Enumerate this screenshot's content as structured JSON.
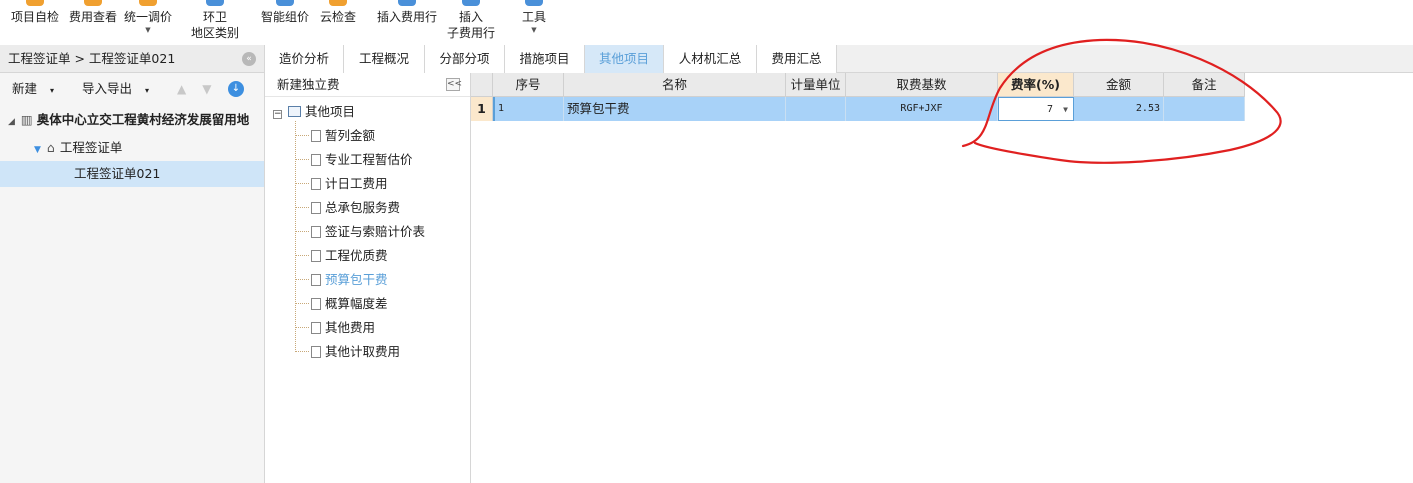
{
  "toolbar": {
    "buttons": [
      {
        "label": "项目自检"
      },
      {
        "label": "费用查看"
      },
      {
        "label": "统一调价"
      },
      {
        "label": "环卫",
        "label2": "地区类别"
      },
      {
        "label": "智能组价"
      },
      {
        "label": "云检查"
      },
      {
        "label": "插入费用行"
      },
      {
        "label": "插入",
        "label2": "子费用行"
      },
      {
        "label": "工具"
      }
    ]
  },
  "left_panel": {
    "breadcrumb": "工程签证单 > 工程签证单021",
    "new_label": "新建",
    "import_export_label": "导入导出",
    "project_name": "奥体中心立交工程黄村经济发展留用地",
    "node_label": "工程签证单",
    "selected_item": "工程签证单021"
  },
  "tabs": [
    "造价分析",
    "工程概况",
    "分部分项",
    "措施项目",
    "其他项目",
    "人材机汇总",
    "费用汇总"
  ],
  "active_tab": "其他项目",
  "middle_panel": {
    "header": "新建独立费",
    "root": "其他项目",
    "items": [
      "暂列金额",
      "专业工程暂估价",
      "计日工费用",
      "总承包服务费",
      "签证与索赔计价表",
      "工程优质费",
      "预算包干费",
      "概算幅度差",
      "其他费用",
      "其他计取费用"
    ],
    "highlighted": "预算包干费"
  },
  "grid": {
    "headers": {
      "seq": "序号",
      "name": "名称",
      "unit": "计量单位",
      "base": "取费基数",
      "rate": "费率(%)",
      "amount": "金额",
      "note": "备注"
    },
    "rows": [
      {
        "rowno": "1",
        "seq": "1",
        "name": "预算包干费",
        "unit": "",
        "base": "RGF+JXF",
        "rate": "7",
        "amount": "2.53",
        "note": ""
      }
    ]
  },
  "colors": {
    "accent": "#5a9fd8",
    "row_selected": "#a8d2f8",
    "rate_header": "#fbe8cc",
    "annotation": "#e02020"
  }
}
